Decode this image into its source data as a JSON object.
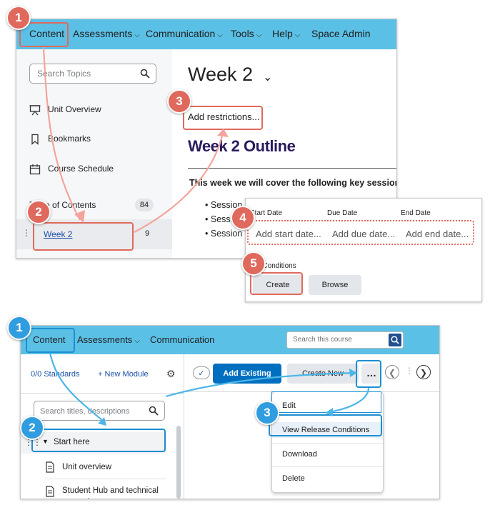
{
  "top": {
    "nav": {
      "content": "Content",
      "assessments": "Assessments",
      "communication": "Communication",
      "tools": "Tools",
      "help": "Help",
      "space_admin": "Space Admin"
    },
    "sidebar": {
      "search_placeholder": "Search Topics",
      "items": [
        {
          "label": "Unit Overview",
          "icon": "presentation-icon"
        },
        {
          "label": "Bookmarks",
          "icon": "bookmark-icon"
        },
        {
          "label": "Course Schedule",
          "icon": "calendar-icon"
        }
      ],
      "toc_label": "Table of Contents",
      "toc_count": "84",
      "week_link": "Week 2",
      "week_count": "9"
    },
    "main": {
      "title": "Week 2",
      "add_restrictions": "Add restrictions...",
      "outline_heading": "Week 2 Outline",
      "intro": "This week we will cover the following key sessions:",
      "bullets": [
        "Session",
        "Session",
        "Session"
      ]
    },
    "restrictions": {
      "start_date_label": "Start Date",
      "due_date_label": "Due Date",
      "end_date_label": "End Date",
      "start_placeholder": "Add start date...",
      "due_placeholder": "Add due date...",
      "end_placeholder": "Add end date...",
      "release_label": "Release Conditions",
      "create": "Create",
      "browse": "Browse"
    },
    "steps": [
      "1",
      "2",
      "3",
      "4",
      "5"
    ]
  },
  "bottom": {
    "nav": {
      "content": "Content",
      "assessments": "Assessments",
      "communication": "Communication",
      "search_placeholder": "Search this course"
    },
    "sidebar": {
      "standards": "0/0 Standards",
      "new_module": "+ New Module",
      "search_placeholder": "Search titles, descriptions",
      "items": [
        "Start here",
        "Unit overview",
        "Student Hub and technical support"
      ]
    },
    "toolbar": {
      "add_existing": "Add Existing",
      "create_new": "Create New",
      "more": "…"
    },
    "menu": [
      "Edit",
      "View Release Conditions",
      "Download",
      "Delete"
    ],
    "steps": [
      "1",
      "2",
      "3"
    ]
  },
  "colors": {
    "nav_bg": "#5bc0e6",
    "highlight_red": "#e0695d",
    "highlight_blue": "#1d8fd0",
    "primary_button": "#006fbf",
    "outline_heading": "#2a1a5e"
  }
}
